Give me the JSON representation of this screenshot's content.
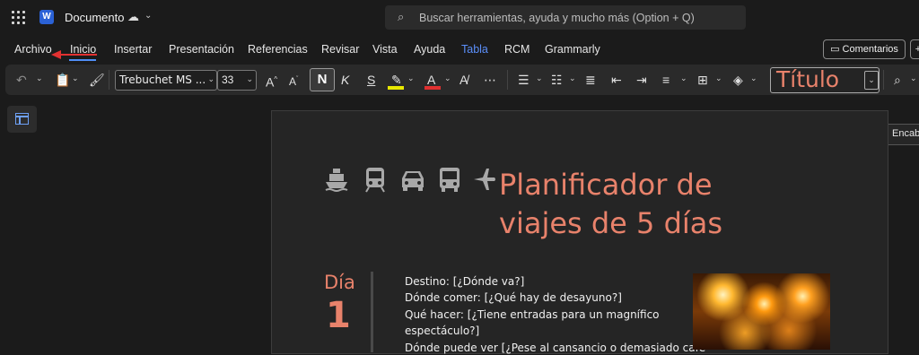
{
  "titlebar": {
    "app_icon": "word-icon",
    "app_letter": "W",
    "doc_name": "Documento",
    "search_placeholder": "Buscar herramientas, ayuda y mucho más (Option + Q)"
  },
  "menu": {
    "items": [
      "Archivo",
      "Inicio",
      "Insertar",
      "Presentación",
      "Referencias",
      "Revisar",
      "Vista",
      "Ayuda",
      "Tabla",
      "RCM",
      "Grammarly"
    ],
    "active": "Inicio",
    "accent_item": "Tabla",
    "comments_label": "Comentarios"
  },
  "ribbon": {
    "font_name": "Trebuchet MS ...",
    "font_size": "33",
    "bold_label": "N",
    "italic_label": "K",
    "underline_label": "S",
    "style_name": "Título"
  },
  "side_panel": {
    "encab_label": "Encab"
  },
  "document": {
    "title_line1": "Planificador de",
    "title_line2": "viajes de 5 días",
    "day_label": "Día",
    "day_number": "1",
    "lines": [
      "Destino: [¿Dónde va?]",
      "Dónde comer: [¿Qué hay de desayuno?]",
      "Qué hacer: [¿Tiene entradas para un magnífico",
      "espectáculo?]",
      "Dónde puede ver [¿Pese al cansancio o demasiado café"
    ],
    "transport_icons": [
      "ship-icon",
      "train-icon",
      "car-icon",
      "bus-icon",
      "airplane-icon"
    ]
  },
  "colors": {
    "accent_title": "#e8826b",
    "tab_accent": "#5b8ff9",
    "annotation_arrow": "#e23131",
    "highlight": "#e8e800",
    "font_color": "#e03030"
  }
}
